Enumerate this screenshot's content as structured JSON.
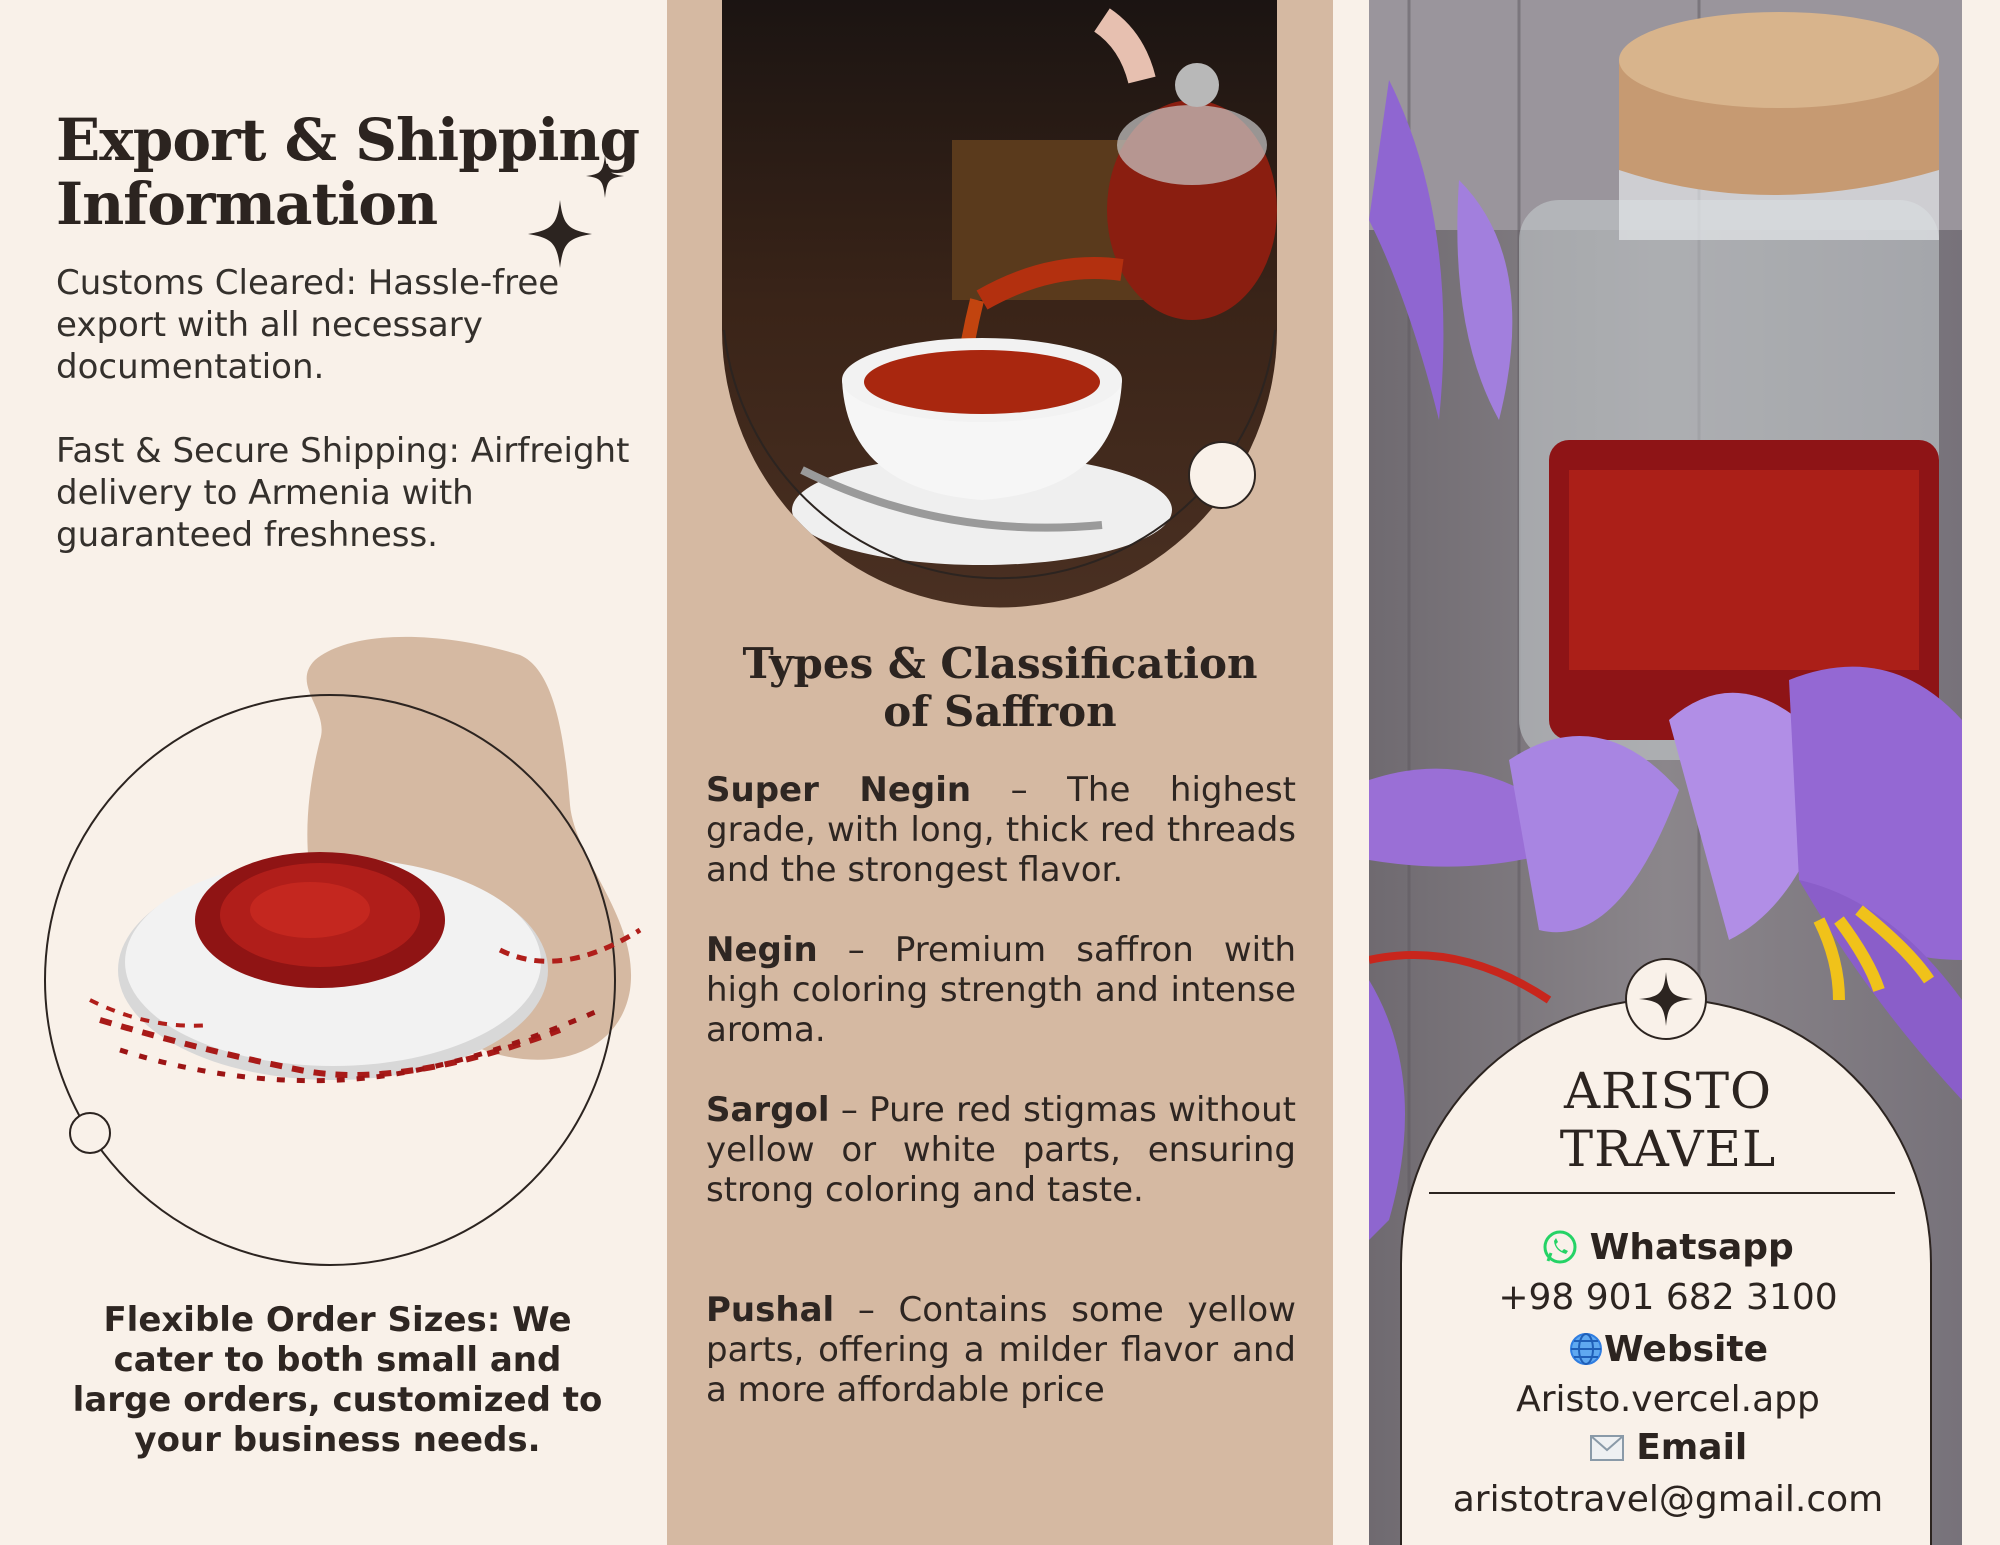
{
  "left": {
    "title_line1": "Export & Shipping",
    "title_line2": "Information",
    "customs": "Customs Cleared: Hassle-free export with all necessary documentation.",
    "shipping": "Fast & Secure Shipping: Airfreight delivery to Armenia with guaranteed freshness.",
    "flexible": "Flexible Order Sizes: We cater to both small and large orders, customized to your business needs."
  },
  "middle": {
    "title_line1": "Types & Classification",
    "title_line2": "of Saffron",
    "types": [
      {
        "name": "Super Negin",
        "desc": " – The highest grade, with long, thick red threads and the strongest flavor."
      },
      {
        "name": "Negin",
        "desc": " – Premium saffron with high coloring strength and intense aroma."
      },
      {
        "name": "Sargol",
        "desc": " – Pure red stigmas without yellow or white parts, ensuring strong coloring and taste."
      },
      {
        "name": "Pushal",
        "desc": " – Contains some yellow parts, offering a milder flavor and a more affordable price"
      }
    ]
  },
  "contact": {
    "brand_line1": "ARISTO",
    "brand_line2": "TRAVEL",
    "whatsapp_label": "Whatsapp",
    "whatsapp_value": "+98 901 682 3100",
    "website_label": "Website",
    "website_value": "Aristo.vercel.app",
    "email_label": "Email",
    "email_value": "aristotravel@gmail.com"
  },
  "colors": {
    "cream": "#f9f1e9",
    "tan": "#d5b9a2",
    "dark_brown": "#2c2420",
    "saffron_red": "#9c1414",
    "crocus_purple": "#9a6fd6",
    "whatsapp_green": "#25d366",
    "globe_blue": "#2f7de1"
  },
  "icons": [
    "sparkle-star-icon",
    "whatsapp-icon",
    "globe-icon",
    "envelope-icon",
    "star-badge-icon"
  ]
}
